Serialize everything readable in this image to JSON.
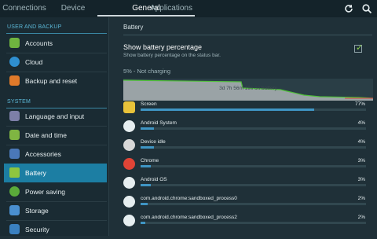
{
  "topbar": {
    "tabs": [
      {
        "label": "Connections"
      },
      {
        "label": "Device"
      },
      {
        "label": "General"
      },
      {
        "label": "Applications"
      }
    ],
    "active_tab": "General",
    "icons": [
      "refresh-icon",
      "search-icon"
    ]
  },
  "sidebar": {
    "sections": [
      {
        "title": "USER AND BACKUP"
      },
      {
        "title": "SYSTEM"
      }
    ],
    "items": [
      {
        "label": "Accounts",
        "icon": "key-icon",
        "color": "#6fb43f"
      },
      {
        "label": "Cloud",
        "icon": "cloud-icon",
        "color": "#2f8fd0"
      },
      {
        "label": "Backup and reset",
        "icon": "backup-icon",
        "color": "#e07a2a"
      },
      {
        "label": "Language and input",
        "icon": "language-icon",
        "color": "#7d7fa8"
      },
      {
        "label": "Date and time",
        "icon": "calendar-icon",
        "color": "#7fb542"
      },
      {
        "label": "Accessories",
        "icon": "accessories-icon",
        "color": "#4a78b8"
      },
      {
        "label": "Battery",
        "icon": "battery-icon",
        "color": "#8ec63f",
        "active": true
      },
      {
        "label": "Power saving",
        "icon": "power-saving-icon",
        "color": "#5aaa3a"
      },
      {
        "label": "Storage",
        "icon": "storage-icon",
        "color": "#4a8fd0"
      },
      {
        "label": "Security",
        "icon": "security-icon",
        "color": "#3a80c0"
      }
    ]
  },
  "main": {
    "title": "Battery",
    "show_pct": {
      "title": "Show battery percentage",
      "subtitle": "Show battery percentage on the status bar.",
      "checked": true
    },
    "status": "5% - Not charging",
    "graph_label": "3d 7h 56m 19s on battery",
    "usage": [
      {
        "name": "Screen",
        "percent": "77%",
        "fraction": 0.77,
        "icon": "screen-icon",
        "color": "#e8c23a"
      },
      {
        "name": "Android System",
        "percent": "4%",
        "fraction": 0.06,
        "icon": "android-icon",
        "color": "#e6eef0"
      },
      {
        "name": "Device idle",
        "percent": "4%",
        "fraction": 0.06,
        "icon": "device-idle-icon",
        "color": "#d7d7d7"
      },
      {
        "name": "Chrome",
        "percent": "3%",
        "fraction": 0.045,
        "icon": "chrome-icon",
        "color": "#e04436"
      },
      {
        "name": "Android OS",
        "percent": "3%",
        "fraction": 0.045,
        "icon": "android-icon",
        "color": "#e6eef0"
      },
      {
        "name": "com.android.chrome:sandboxed_process0",
        "percent": "2%",
        "fraction": 0.03,
        "icon": "android-icon",
        "color": "#e6eef0"
      },
      {
        "name": "com.android.chrome:sandboxed_process2",
        "percent": "2%",
        "fraction": 0.02,
        "icon": "android-icon",
        "color": "#e6eef0"
      }
    ]
  }
}
